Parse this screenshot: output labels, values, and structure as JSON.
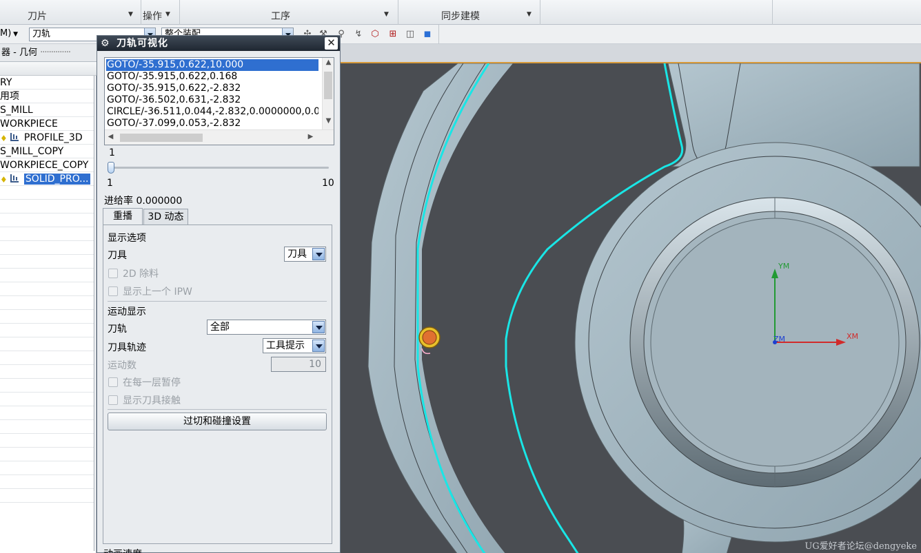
{
  "ribbon": {
    "groups": [
      {
        "label": "刀片"
      },
      {
        "label": "操作"
      },
      {
        "label": "工序"
      },
      {
        "label": "同步建模"
      }
    ]
  },
  "toolbar": {
    "mode_label": "M)",
    "filter_value": "刀轨",
    "assembly_value": "整个装配"
  },
  "navigator": {
    "title": "器 - 几何",
    "rows": [
      {
        "label": "RY",
        "icon": "none"
      },
      {
        "label": "用项",
        "icon": "none"
      },
      {
        "label": "S_MILL",
        "icon": "none"
      },
      {
        "label": "WORKPIECE",
        "icon": "none"
      },
      {
        "label": "PROFILE_3D",
        "icon": "operation-icon"
      },
      {
        "label": "S_MILL_COPY",
        "icon": "none"
      },
      {
        "label": "WORKPIECE_COPY",
        "icon": "none"
      },
      {
        "label": "SOLID_PRO...",
        "icon": "operation-icon",
        "selected": true
      }
    ]
  },
  "dialog": {
    "title": "刀轨可视化",
    "list_items": [
      "GOTO/-35.915,0.622,10.000",
      "GOTO/-35.915,0.622,0.168",
      "GOTO/-35.915,0.622,-2.832",
      "GOTO/-36.502,0.631,-2.832",
      "CIRCLE/-36.511,0.044,-2.832,0.0000000,0.0",
      "GOTO/-37.099,0.053,-2.832"
    ],
    "slider": {
      "current_label": "1",
      "min_label": "1",
      "max_label": "10",
      "value": 1
    },
    "feed_rate_label": "进给率 0.000000",
    "tabs": [
      {
        "label": "重播",
        "active": true
      },
      {
        "label": "3D 动态",
        "active": false
      }
    ],
    "display_options": {
      "heading": "显示选项",
      "tool_label": "刀具",
      "tool_value": "刀具",
      "remove_2d_label": "2D 除料",
      "show_prev_ipw_label": "显示上一个 IPW"
    },
    "motion_display": {
      "heading": "运动显示",
      "path_label": "刀轨",
      "path_value": "全部",
      "trace_label": "刀具轨迹",
      "trace_value": "工具提示",
      "count_label": "运动数",
      "count_value": "10",
      "pause_label": "在每一层暂停",
      "show_contact_label": "显示刀具接触"
    },
    "collision_button": "过切和碰撞设置",
    "animation_speed_label": "动画速度"
  },
  "viewport": {
    "axis_y": "YM",
    "axis_x": "XM",
    "axis_z": "ZM",
    "watermark": "UG爱好者论坛@dengyeke",
    "colors": {
      "toolpath": "#19e6e6",
      "part": "#9fb4bf",
      "background": "#4a4d52",
      "tool": "#e8a72a"
    }
  }
}
